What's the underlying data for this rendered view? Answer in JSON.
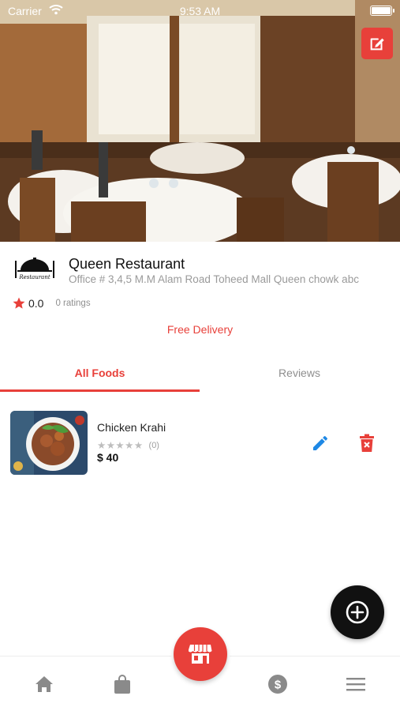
{
  "status_bar": {
    "carrier": "Carrier",
    "time": "9:53 AM"
  },
  "hero": {
    "edit_icon": "edit-square-icon"
  },
  "restaurant": {
    "name": "Queen Restaurant",
    "logo_text": "Restaurant",
    "address": "Office # 3,4,5 M.M Alam Road Toheed Mall  Queen chowk abc",
    "rating": "0.0",
    "ratings_count": "0 ratings",
    "delivery": "Free Delivery"
  },
  "tabs": [
    {
      "label": "All Foods",
      "active": true
    },
    {
      "label": "Reviews",
      "active": false
    }
  ],
  "foods": [
    {
      "name": "Chicken Krahi",
      "stars": "★★★★★",
      "reviews": "(0)",
      "price": "$ 40"
    }
  ],
  "nav": {
    "items": [
      "home-icon",
      "shopping-bag-icon",
      "store-icon",
      "dollar-icon",
      "menu-icon"
    ]
  },
  "colors": {
    "accent": "#e8403a",
    "edit_blue": "#1e88e5",
    "fab": "#111111"
  }
}
